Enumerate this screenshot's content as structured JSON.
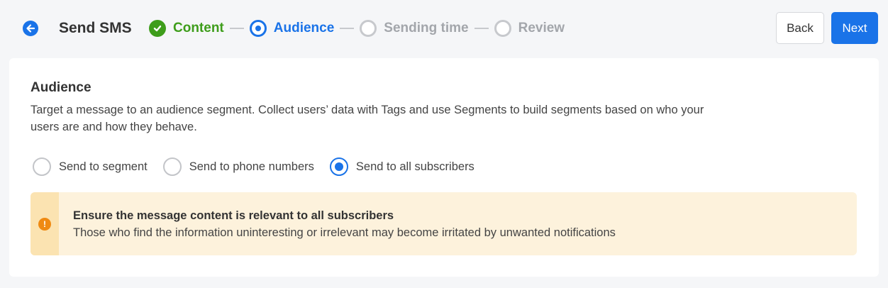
{
  "header": {
    "back_icon": "arrow-left-icon",
    "title": "Send SMS",
    "steps": [
      {
        "label": "Content",
        "state": "done",
        "icon": "check-circle-icon"
      },
      {
        "label": "Audience",
        "state": "active",
        "icon": "radio-active-icon"
      },
      {
        "label": "Sending time",
        "state": "pending",
        "icon": "radio-empty-icon"
      },
      {
        "label": "Review",
        "state": "pending",
        "icon": "radio-empty-icon"
      }
    ],
    "back_label": "Back",
    "next_label": "Next"
  },
  "audience": {
    "title": "Audience",
    "description": "Target a message to an audience segment. Collect users’ data with Tags and use Segments to build segments based on who your users are and how they behave.",
    "options": [
      {
        "label": "Send to segment",
        "checked": false
      },
      {
        "label": "Send to phone numbers",
        "checked": false
      },
      {
        "label": "Send to all subscribers",
        "checked": true
      }
    ],
    "alert": {
      "icon": "exclamation-circle-icon",
      "title": "Ensure the message content is relevant to all subscribers",
      "text": "Those who find the information uninteresting or irrelevant may become irritated by unwanted notifications"
    }
  },
  "colors": {
    "accent": "#1a73e8",
    "success": "#3e9d1b",
    "pending": "#a3a6ab",
    "warning": "#ef8a12",
    "alert_bg": "#fdf2dc"
  }
}
